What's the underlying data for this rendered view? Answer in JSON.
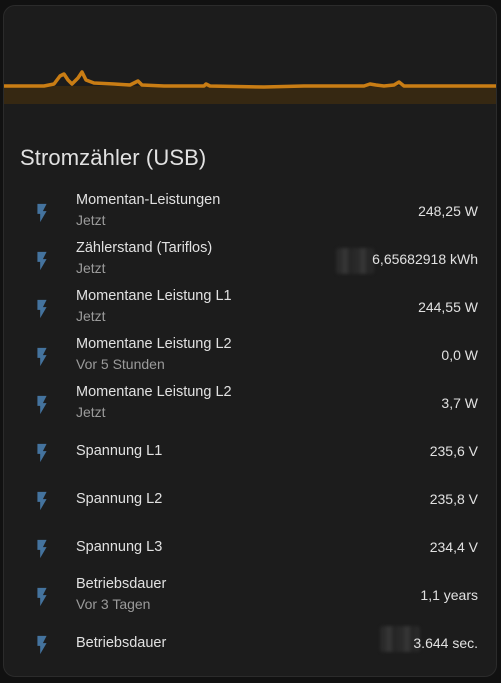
{
  "card": {
    "title": "Stromzähler (USB)",
    "accent_color": "#c97d14"
  },
  "entities": [
    {
      "name": "Momentan-Leistungen",
      "secondary": "Jetzt",
      "value": "248,25 W",
      "icon": "flash-icon"
    },
    {
      "name": "Zählerstand (Tariflos)",
      "secondary": "Jetzt",
      "value": "6,65682918 kWh",
      "icon": "flash-icon"
    },
    {
      "name": "Momentane Leistung L1",
      "secondary": "Jetzt",
      "value": "244,55 W",
      "icon": "flash-icon"
    },
    {
      "name": "Momentane Leistung L2",
      "secondary": "Vor 5 Stunden",
      "value": "0,0 W",
      "icon": "flash-icon"
    },
    {
      "name": "Momentane Leistung L2",
      "secondary": "Jetzt",
      "value": "3,7 W",
      "icon": "flash-icon"
    },
    {
      "name": "Spannung L1",
      "secondary": "",
      "value": "235,6 V",
      "icon": "flash-icon"
    },
    {
      "name": "Spannung L2",
      "secondary": "",
      "value": "235,8 V",
      "icon": "flash-icon"
    },
    {
      "name": "Spannung L3",
      "secondary": "",
      "value": "234,4 V",
      "icon": "flash-icon"
    },
    {
      "name": "Betriebsdauer",
      "secondary": "Vor 3 Tagen",
      "value": "1,1 years",
      "icon": "flash-icon"
    },
    {
      "name": "Betriebsdauer",
      "secondary": "",
      "value": "3.644 sec.",
      "icon": "flash-icon"
    }
  ]
}
